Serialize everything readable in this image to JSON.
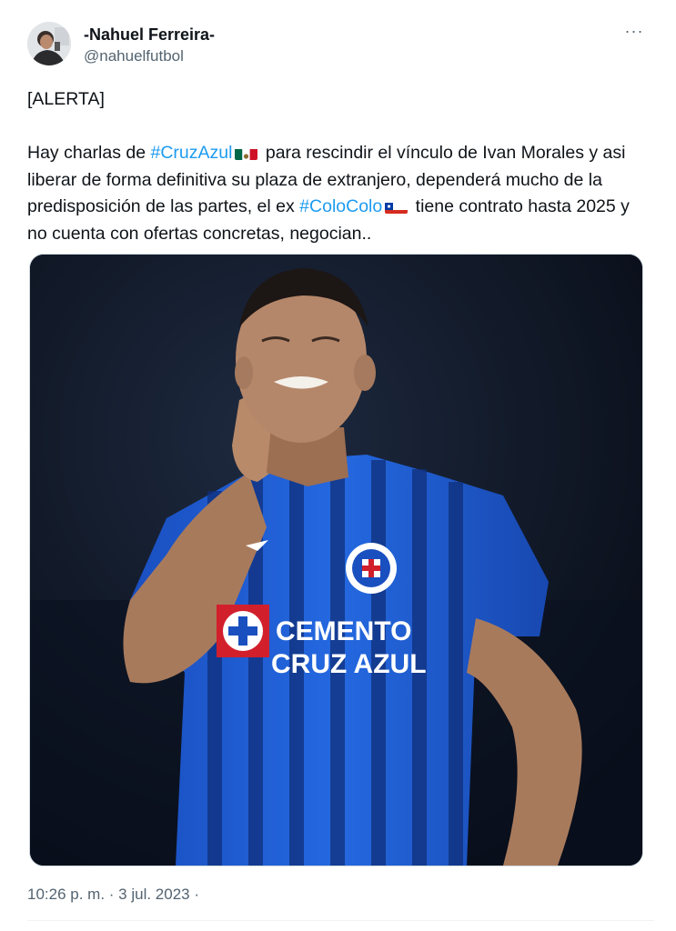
{
  "author": {
    "display_name": "-Nahuel Ferreira-",
    "handle": "@nahuelfutbol"
  },
  "menu": {
    "more_label": "···"
  },
  "tweet": {
    "alert": "[ALERTA]",
    "segments": {
      "s1": "Hay charlas de ",
      "h1": "#CruzAzul",
      "s2": " para rescindir el vínculo de Ivan Morales y asi liberar de forma definitiva su plaza de extranjero, dependerá mucho de la predisposición de las partes, el ex ",
      "h2": "#ColoColo",
      "s3": " tiene contrato hasta 2025 y no cuenta con ofertas concretas, negocian.."
    }
  },
  "media": {
    "jersey_text_line1": "CEMENTO",
    "jersey_text_line2": "CRUZ AZUL"
  },
  "timestamp": {
    "time": "10:26 p. m.",
    "separator": " · ",
    "date": "3 jul. 2023",
    "trail": " ·"
  },
  "colors": {
    "link": "#1d9bf0",
    "secondary_text": "#536471",
    "jersey_blue": "#1f5fd6"
  },
  "icons": {
    "mexico_flag": "mexico-flag-icon",
    "chile_flag": "chile-flag-icon",
    "more": "more-icon"
  }
}
